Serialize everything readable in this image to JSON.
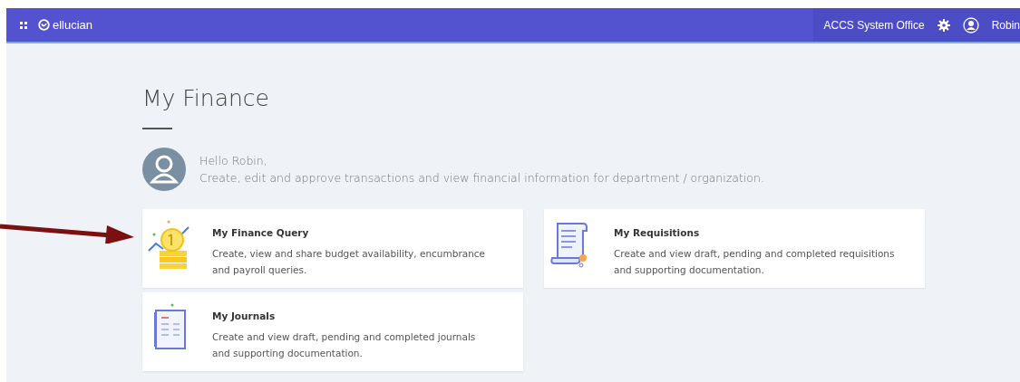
{
  "header": {
    "brand": "ellucian",
    "institution": "ACCS System Office",
    "user": "Robin"
  },
  "page": {
    "title": "My Finance",
    "greeting": "Hello Robin,",
    "intro": "Create, edit and approve transactions and view financial information for department / organization."
  },
  "cards": [
    {
      "kind": "query",
      "title": "My Finance Query",
      "description": "Create, view and share budget availability, encumbrance and payroll queries."
    },
    {
      "kind": "requisitions",
      "title": "My Requisitions",
      "description": "Create and view draft, pending and completed requisitions and supporting documentation."
    },
    {
      "kind": "journals",
      "title": "My Journals",
      "description": "Create and view draft, pending and completed journals and supporting documentation."
    }
  ]
}
